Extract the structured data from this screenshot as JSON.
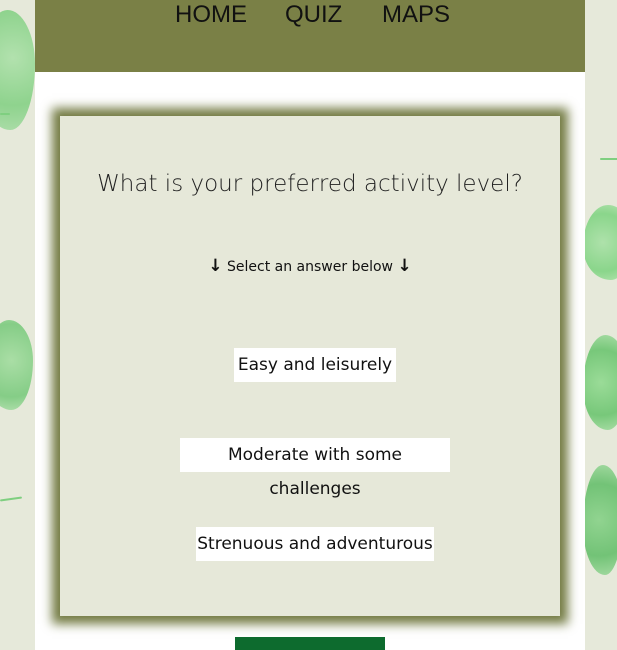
{
  "nav": {
    "home": "HOME",
    "quiz": "QUIZ",
    "maps": "MAPS"
  },
  "quiz": {
    "question": "What is your preferred activity level?",
    "hint": "Select an answer below",
    "answers": [
      "Easy and leisurely",
      "Moderate with some challenges",
      "Strenuous and adventurous"
    ]
  },
  "icons": {
    "hint_left": "arrow-down-icon",
    "hint_right": "arrow-down-icon"
  },
  "colors": {
    "nav_bg": "#7a8046",
    "card_bg": "#e6e8d9",
    "card_border": "#747c44",
    "submit_bg": "#0d6b2e",
    "page_bg": "#e6e9da"
  }
}
